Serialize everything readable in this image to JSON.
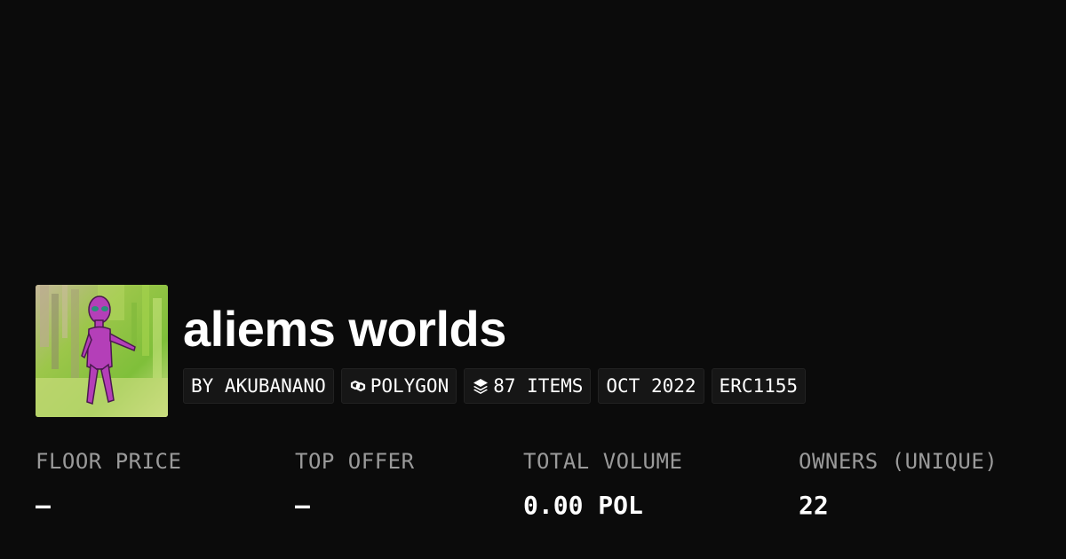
{
  "collection": {
    "name": "aliems worlds",
    "thumbnail_icon": "alien-figure-artwork"
  },
  "badges": [
    {
      "label": "BY AKUBANANO",
      "icon": null
    },
    {
      "label": "POLYGON",
      "icon": "polygon-chain-icon"
    },
    {
      "label": "87 ITEMS",
      "icon": "layers-icon"
    },
    {
      "label": "OCT 2022",
      "icon": null
    },
    {
      "label": "ERC1155",
      "icon": null
    }
  ],
  "stats": [
    {
      "label": "FLOOR PRICE",
      "value": "–"
    },
    {
      "label": "TOP OFFER",
      "value": "–"
    },
    {
      "label": "TOTAL VOLUME",
      "value": "0.00 POL"
    },
    {
      "label": "OWNERS (UNIQUE)",
      "value": "22"
    }
  ],
  "colors": {
    "background": "#0b0b0b",
    "badge_background": "#161616",
    "label_gray": "#9a9a9a",
    "text": "#ffffff"
  }
}
